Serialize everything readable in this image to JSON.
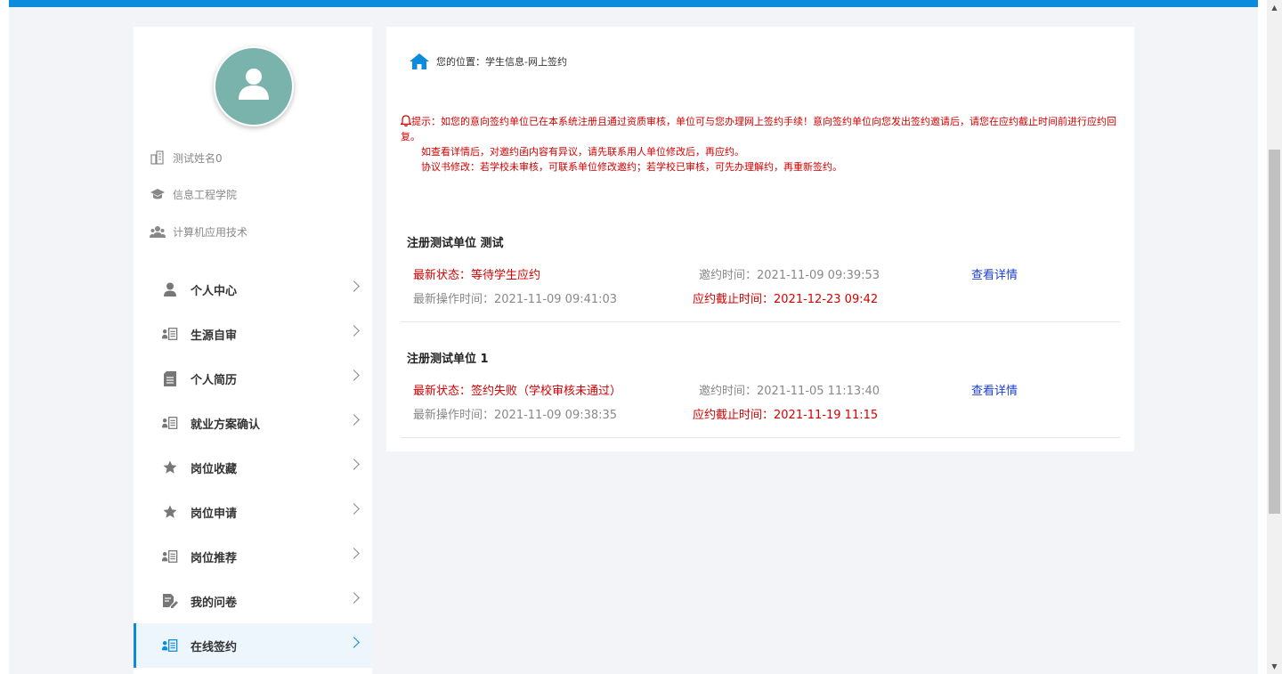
{
  "sidebar": {
    "profile": {
      "name": "测试姓名0",
      "college": "信息工程学院",
      "major": "计算机应用技术"
    },
    "menu": [
      {
        "label": "个人中心",
        "icon": "person-icon"
      },
      {
        "label": "生源自审",
        "icon": "id-list-icon"
      },
      {
        "label": "个人简历",
        "icon": "document-icon"
      },
      {
        "label": "就业方案确认",
        "icon": "id-list-icon"
      },
      {
        "label": "岗位收藏",
        "icon": "star-icon"
      },
      {
        "label": "岗位申请",
        "icon": "star-icon"
      },
      {
        "label": "岗位推荐",
        "icon": "id-list-icon"
      },
      {
        "label": "我的问卷",
        "icon": "questionnaire-icon"
      },
      {
        "label": "在线签约",
        "icon": "id-list-icon",
        "active": true
      }
    ]
  },
  "breadcrumb": {
    "text": "您的位置：学生信息-网上签约"
  },
  "notice": {
    "line1": "提示：如您的意向签约单位已在本系统注册且通过资质审核，单位可与您办理网上签约手续！意向签约单位向您发出签约邀请后，请您在应约截止时间前进行应约回复。",
    "line2": "如查看详情后，对邀约函内容有异议，请先联系用人单位修改后，再应约。",
    "line3": "协议书修改：若学校未审核，可联系单位修改邀约；若学校已审核，可先办理解约，再重新签约。"
  },
  "records": [
    {
      "company": "注册测试单位 测试",
      "status": "最新状态：等待学生应约",
      "invite_time": "邀约时间：2021-11-09 09:39:53",
      "detail_link": "查看详情",
      "operate_time": "最新操作时间：2021-11-09 09:41:03",
      "deadline": "应约截止时间：2021-12-23 09:42"
    },
    {
      "company": "注册测试单位 1",
      "status": "最新状态：签约失败（学校审核未通过）",
      "invite_time": "邀约时间：2021-11-05 11:13:40",
      "detail_link": "查看详情",
      "operate_time": "最新操作时间：2021-11-09 09:38:35",
      "deadline": "应约截止时间：2021-11-19 11:15"
    }
  ],
  "colors": {
    "accent": "#0a8bdb",
    "warning": "#d40000",
    "link": "#1a3fd6",
    "avatar_bg": "#7ab3ab"
  }
}
